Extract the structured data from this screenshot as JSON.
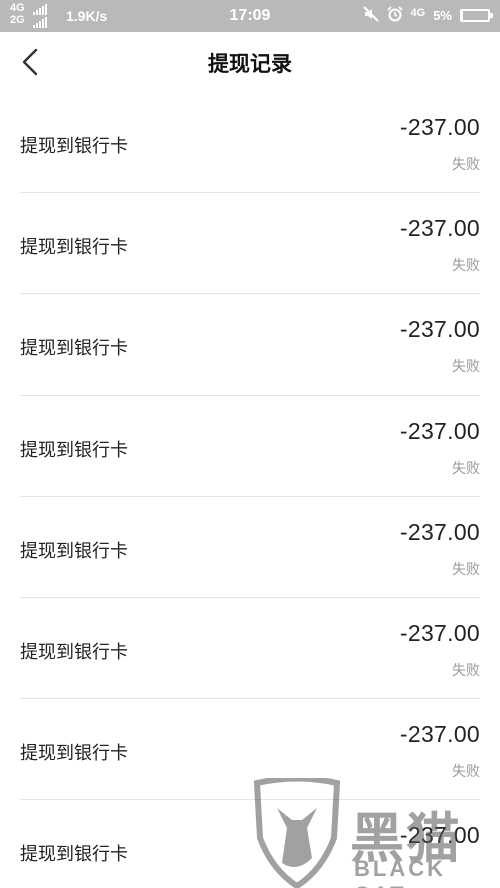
{
  "status_bar": {
    "network_top": "4G",
    "network_bottom": "2G",
    "speed": "1.9K/s",
    "time": "17:09",
    "signal_right": "4G",
    "battery_percent": "5%",
    "battery_level": 0.05
  },
  "header": {
    "title": "提现记录",
    "back_icon": "chevron-left-icon"
  },
  "records": [
    {
      "label": "提现到银行卡",
      "amount": "-237.00",
      "status": "失败"
    },
    {
      "label": "提现到银行卡",
      "amount": "-237.00",
      "status": "失败"
    },
    {
      "label": "提现到银行卡",
      "amount": "-237.00",
      "status": "失败"
    },
    {
      "label": "提现到银行卡",
      "amount": "-237.00",
      "status": "失败"
    },
    {
      "label": "提现到银行卡",
      "amount": "-237.00",
      "status": "失败"
    },
    {
      "label": "提现到银行卡",
      "amount": "-237.00",
      "status": "失败"
    },
    {
      "label": "提现到银行卡",
      "amount": "-237.00",
      "status": "失败"
    },
    {
      "label": "提现到银行卡",
      "amount": "-237.00",
      "status": ""
    }
  ],
  "watermark": {
    "text": "黑猫",
    "subtext": "BLACK CAT"
  },
  "colors": {
    "status_bar_bg": "#b9b9b9",
    "status_text": "#9a9a9a",
    "divider": "#e3e3e3"
  }
}
